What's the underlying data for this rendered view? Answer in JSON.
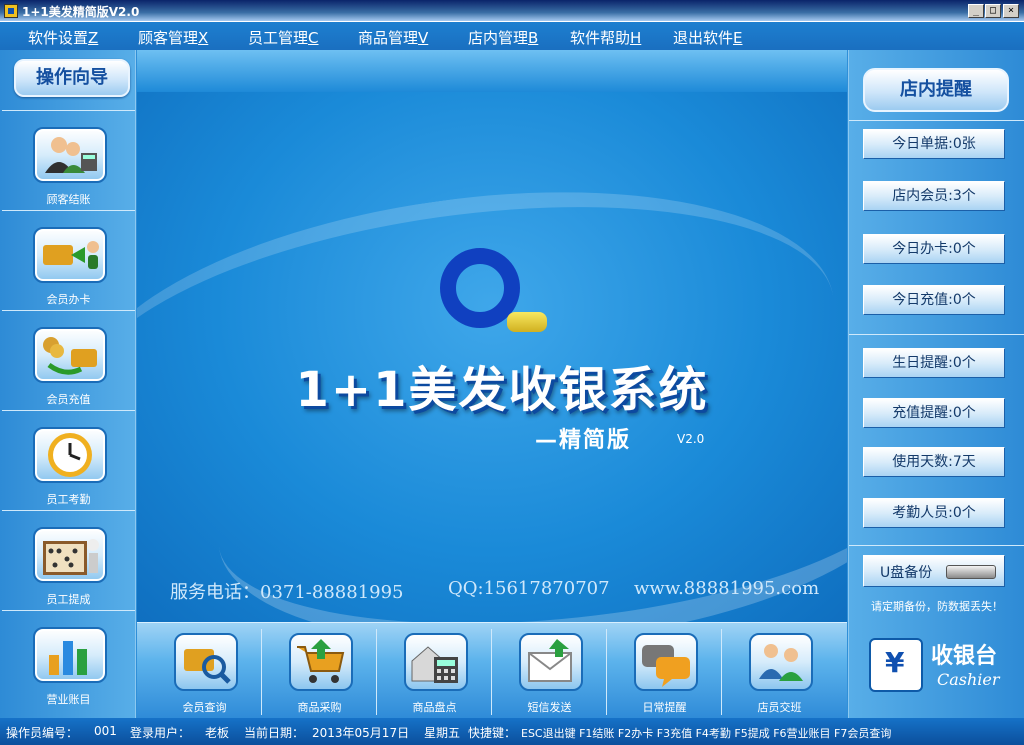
{
  "window": {
    "title": "1+1美发精简版V2.0",
    "controls": {
      "minimize": "_",
      "maximize": "□",
      "close": "×"
    }
  },
  "menu": [
    {
      "label": "软件设置",
      "key": "Z"
    },
    {
      "label": "顾客管理",
      "key": "X"
    },
    {
      "label": "员工管理",
      "key": "C"
    },
    {
      "label": "商品管理",
      "key": "V"
    },
    {
      "label": "店内管理",
      "key": "B"
    },
    {
      "label": "软件帮助",
      "key": "H"
    },
    {
      "label": "退出软件",
      "key": "E"
    }
  ],
  "left": {
    "title": "操作向导",
    "items": [
      {
        "label": "顾客结账",
        "icon": "customer-checkout-icon"
      },
      {
        "label": "会员办卡",
        "icon": "member-card-icon"
      },
      {
        "label": "会员充值",
        "icon": "member-recharge-icon"
      },
      {
        "label": "员工考勤",
        "icon": "clock-icon"
      },
      {
        "label": "员工提成",
        "icon": "abacus-icon"
      },
      {
        "label": "营业账目",
        "icon": "bar-chart-icon"
      }
    ]
  },
  "center": {
    "title": "1+1美发收银系统",
    "subtitle": "—精简版",
    "version": "V2.0",
    "phone": "服务电话：0371-88881995",
    "qq": "QQ:15617870707",
    "website": "www.88881995.com"
  },
  "bottom": {
    "items": [
      {
        "label": "会员查询",
        "icon": "member-search-icon"
      },
      {
        "label": "商品采购",
        "icon": "shopping-cart-icon"
      },
      {
        "label": "商品盘点",
        "icon": "inventory-calculator-icon"
      },
      {
        "label": "短信发送",
        "icon": "envelope-icon"
      },
      {
        "label": "日常提醒",
        "icon": "chat-bubble-icon"
      },
      {
        "label": "店员交班",
        "icon": "staff-handover-icon"
      }
    ]
  },
  "right": {
    "title": "店内提醒",
    "group1": [
      "今日单据:0张",
      "店内会员:3个",
      "今日办卡:0个",
      "今日充值:0个"
    ],
    "group2": [
      "生日提醒:0个",
      "充值提醒:0个",
      "使用天数:7天",
      "考勤人员:0个"
    ],
    "backup_label": "U盘备份",
    "backup_note": "请定期备份，防数据丢失！",
    "cashier_cn": "收银台",
    "cashier_en": "Cashier"
  },
  "status": {
    "operator_label": "操作员编号：",
    "operator_value": "001",
    "user_label": "登录用户：",
    "user_value": "老板",
    "date_label": "当前日期：",
    "date_value": "2013年05月17日",
    "weekday": "星期五",
    "shortcuts_label": "快捷键：",
    "shortcuts": "ESC退出键  F1结账  F2办卡  F3充值  F4考勤  F5提成  F6营业账目  F7会员查询"
  },
  "colors": {
    "accent": "#1a8ad8",
    "title_blue": "#1550a0",
    "logo_blue": "#1040c0"
  }
}
